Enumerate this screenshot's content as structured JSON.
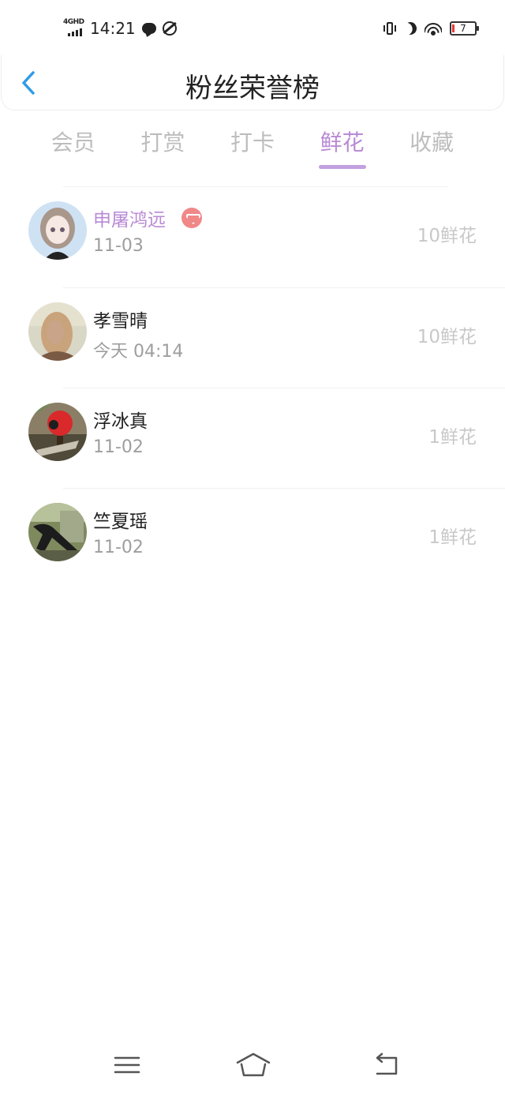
{
  "status_bar": {
    "network": "4GHD",
    "time": "14:21",
    "battery": "7",
    "icons": [
      "signal-icon",
      "chat-bubble-icon",
      "app-icon",
      "vibrate-icon",
      "moon-icon",
      "wifi-icon",
      "battery-icon"
    ]
  },
  "header": {
    "back_icon": "chevron-left-icon",
    "title": "粉丝荣誉榜"
  },
  "tabs": [
    {
      "label": "会员",
      "active": false
    },
    {
      "label": "打赏",
      "active": false
    },
    {
      "label": "打卡",
      "active": false
    },
    {
      "label": "鲜花",
      "active": true
    },
    {
      "label": "收藏",
      "active": false
    }
  ],
  "fans": [
    {
      "name": "申屠鸿远",
      "date": "11-03",
      "amount": "10鲜花",
      "vip": true
    },
    {
      "name": "孝雪晴",
      "date": "今天  04:14",
      "amount": "10鲜花",
      "vip": false
    },
    {
      "name": "浮冰真",
      "date": "11-02",
      "amount": "1鲜花",
      "vip": false
    },
    {
      "name": "竺夏瑶",
      "date": "11-02",
      "amount": "1鲜花",
      "vip": false
    }
  ],
  "nav_bar": {
    "icons": [
      "menu-icon",
      "home-icon",
      "back-icon"
    ]
  },
  "colors": {
    "accent": "#b98ad6",
    "back_arrow": "#2f9be6",
    "badge": "#f08888"
  }
}
